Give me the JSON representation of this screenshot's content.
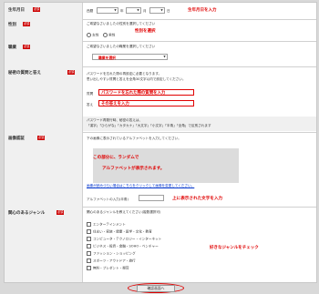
{
  "required_badge": "必須",
  "birthday": {
    "label": "生年月日",
    "era": "西暦",
    "year_unit": "年",
    "month_unit": "月",
    "day_unit": "日",
    "annotation": "生年月日を入力"
  },
  "gender": {
    "label": "性別",
    "instruction": "ご希望なさいましたの性別を選択してください",
    "annotation": "性別を選択",
    "option_female": "女性",
    "option_male": "男性"
  },
  "occupation": {
    "label": "職業",
    "instruction": "ご希望なさいましたの職業を選択してください",
    "select_value": "職業を選択"
  },
  "secret": {
    "label": "秘密の質問と答え",
    "line1": "パスワードを忘れた際の再設定に必要となります。",
    "line2": "思い出しやすい質問と答えを全角30文字以内で設定してください。",
    "question_label": "質問",
    "answer_label": "答え",
    "question_annotation": "パスワードを忘れた際の質問を入力",
    "answer_annotation": "その答えを入力",
    "note1": "パスワード再発行時、秘密の答えは、",
    "note2": "「漢字」「ひらがな」「カタカナ」「大文字」「小文字」「半角」「全角」で区別されます"
  },
  "captcha": {
    "label": "画像認証",
    "instruction": "下の画像に表示されているアルファベットを入力してください。",
    "annotation_line1": "この部分に、ランダムで",
    "annotation_line2": "アルファベットが表示されます。",
    "refresh_link": "画像が読みづらい場合はこちらをクリックして画像を変更してください。",
    "input_label": "アルファベットの入力(半角)",
    "input_annotation": "上に表示された文字を入力"
  },
  "interests": {
    "label": "関心のあるジャンル",
    "instruction": "関心のあるジャンルを教えてください(複数選択可)",
    "annotation": "好きなジャンルをチェック",
    "options": [
      "エンターテインメント",
      "住まい・家族・健康・医学・文化・教育",
      "コンピュータ・テクノロジー・インターネット",
      "ビジネス・投資・金融・SOHO・ベンチャー",
      "ファッション・ショッピング",
      "スポーツ・アウトドア・旅行",
      "無料・プレゼント・懸賞"
    ]
  },
  "confirm_button": "確認画面へ"
}
